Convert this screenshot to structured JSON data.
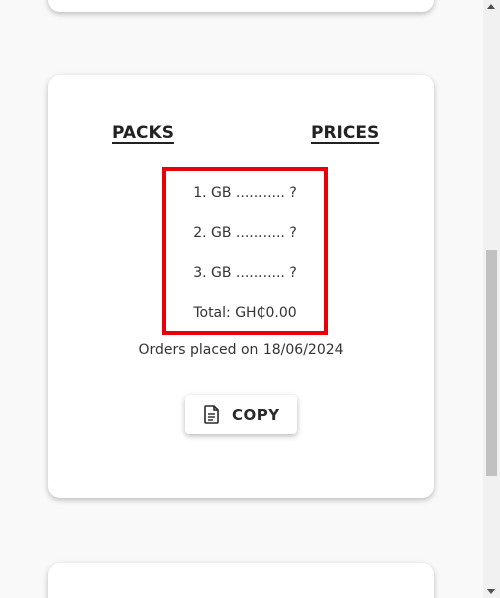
{
  "table": {
    "packs_header": "PACKS",
    "prices_header": "PRICES"
  },
  "order": {
    "lines": [
      "1. GB ........... ?",
      "2. GB ........... ?",
      "3. GB ........... ?"
    ],
    "total": "Total: GH₵0.00"
  },
  "orders_placed": "Orders placed on 18/06/2024",
  "copy_button": {
    "label": "COPY",
    "icon": "document-copy-icon"
  },
  "colors": {
    "highlight_border": "#e8000b"
  },
  "scrollbar": {
    "scroll_position": 0.42
  }
}
